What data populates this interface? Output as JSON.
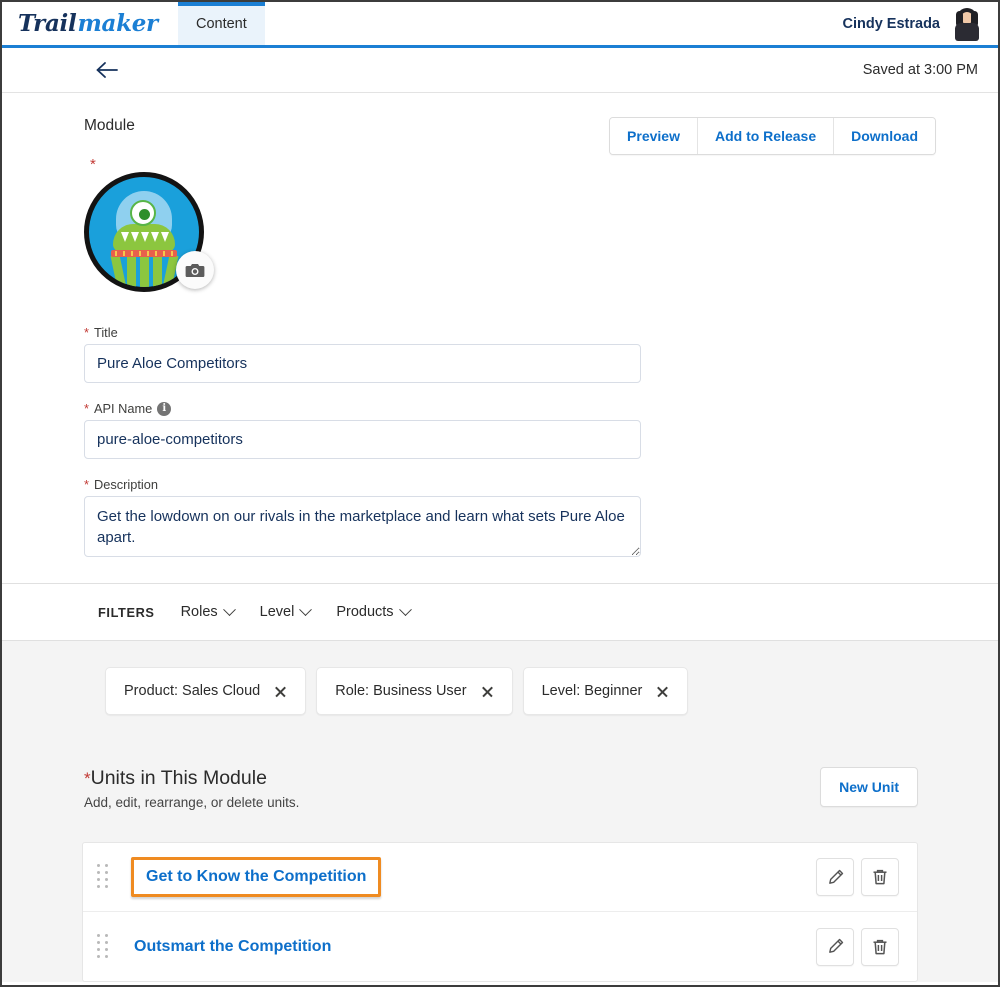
{
  "topnav": {
    "logo_part1": "Trail",
    "logo_part2": "maker",
    "tab_label": "Content",
    "user_name": "Cindy Estrada",
    "avatar_icon": "user-avatar-icon",
    "accent_color": "#1b7fd4"
  },
  "subheader": {
    "back_icon": "back-arrow-icon",
    "saved_text": "Saved at 3:00 PM"
  },
  "module": {
    "type_label": "Module",
    "image_required_star": "*",
    "image_icon": "alien-module-avatar",
    "camera_icon": "camera-icon",
    "actions": [
      {
        "label": "Preview"
      },
      {
        "label": "Add to Release"
      },
      {
        "label": "Download"
      }
    ]
  },
  "fields": {
    "title": {
      "star": "*",
      "label": "Title",
      "value": "Pure Aloe Competitors",
      "placeholder": ""
    },
    "api_name": {
      "star": "*",
      "label": "API Name",
      "info_icon": "info-icon",
      "info_glyph": "i",
      "value": "pure-aloe-competitors",
      "placeholder": ""
    },
    "description": {
      "star": "*",
      "label": "Description",
      "value": "Get the lowdown on our rivals in the marketplace and learn what sets Pure Aloe apart.",
      "placeholder": ""
    }
  },
  "filters": {
    "title": "FILTERS",
    "dropdowns": [
      {
        "label": "Roles",
        "icon": "chevron-down-icon"
      },
      {
        "label": "Level",
        "icon": "chevron-down-icon"
      },
      {
        "label": "Products",
        "icon": "chevron-down-icon"
      }
    ],
    "pills": [
      {
        "label": "Product: Sales Cloud",
        "remove_icon": "close-icon"
      },
      {
        "label": "Role: Business User",
        "remove_icon": "close-icon"
      },
      {
        "label": "Level: Beginner",
        "remove_icon": "close-icon"
      }
    ]
  },
  "units": {
    "star": "*",
    "title": "Units in This Module",
    "subtitle": "Add, edit, rearrange, or delete units.",
    "new_unit_label": "New Unit",
    "highlight_color": "#ef8b21",
    "rows": [
      {
        "drag_icon": "drag-handle-icon",
        "label": "Get to Know the Competition",
        "highlighted": true,
        "edit_icon": "pencil-icon",
        "delete_icon": "trash-icon"
      },
      {
        "drag_icon": "drag-handle-icon",
        "label": "Outsmart the Competition",
        "highlighted": false,
        "edit_icon": "pencil-icon",
        "delete_icon": "trash-icon"
      }
    ]
  }
}
